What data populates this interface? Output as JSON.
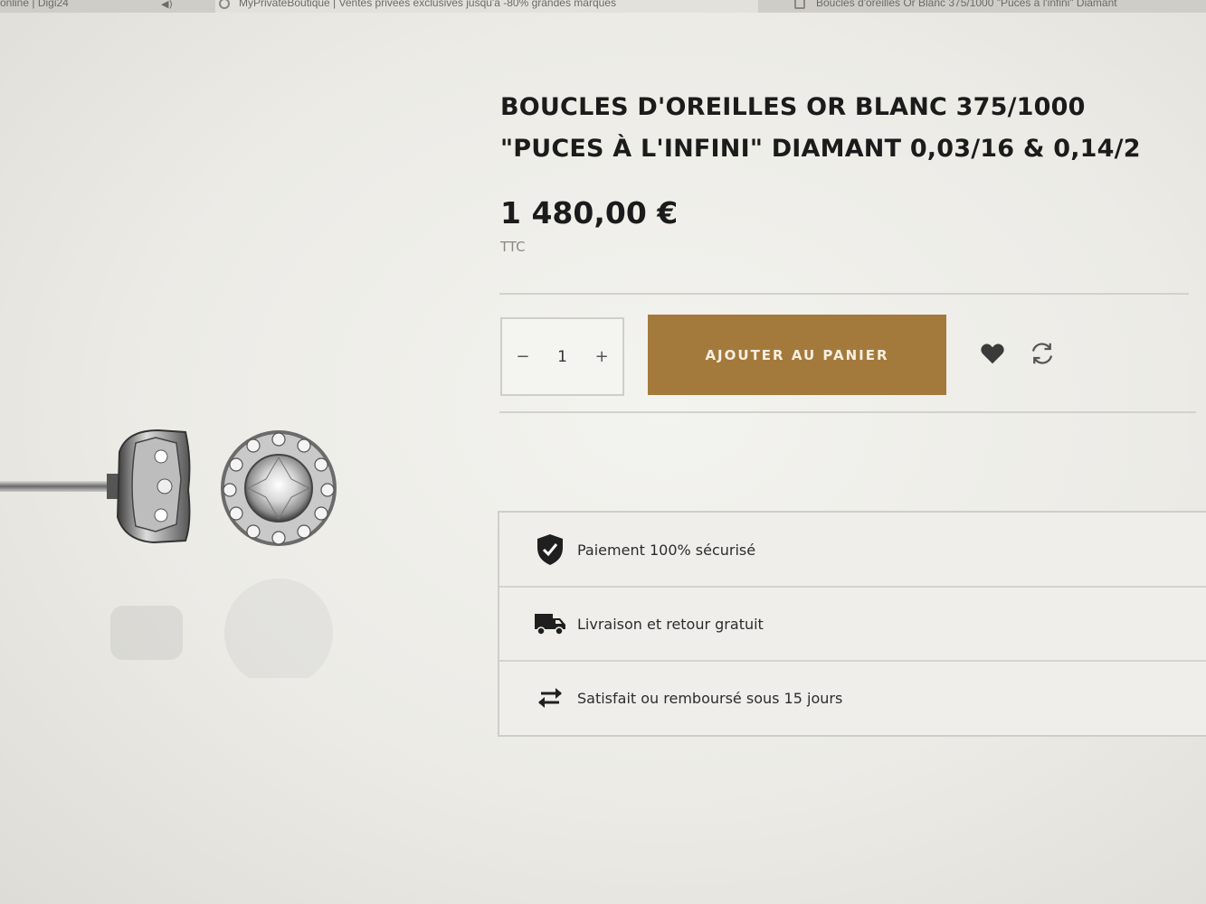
{
  "browser": {
    "tabs": [
      {
        "label": "online | Digi24"
      },
      {
        "label": "MyPrivateBoutique | Ventes privées exclusives jusqu'à -80% grandes marques"
      },
      {
        "label": "Boucles d'oreilles Or Blanc 375/1000 \"Puces à l'infini\" Diamant"
      }
    ]
  },
  "product": {
    "title_line1": "BOUCLES D'OREILLES OR BLANC 375/1000",
    "title_line2": "\"PUCES À L'INFINI\" DIAMANT 0,03/16 & 0,14/2",
    "price": "1 480,00 €",
    "tax_label": "TTC",
    "image_icon": "diamond-stud-earrings-image"
  },
  "cart": {
    "quantity": "1",
    "decrement_label": "−",
    "increment_label": "+",
    "add_button_label": "AJOUTER AU PANIER",
    "accent_color": "#a47a3c",
    "wishlist_icon": "heart-icon",
    "compare_icon": "refresh-icon"
  },
  "reassurance": [
    {
      "icon": "shield-check-icon",
      "label": "Paiement 100% sécurisé"
    },
    {
      "icon": "truck-icon",
      "label": "Livraison et retour gratuit"
    },
    {
      "icon": "arrows-exchange-icon",
      "label": "Satisfait ou remboursé sous 15 jours"
    }
  ]
}
